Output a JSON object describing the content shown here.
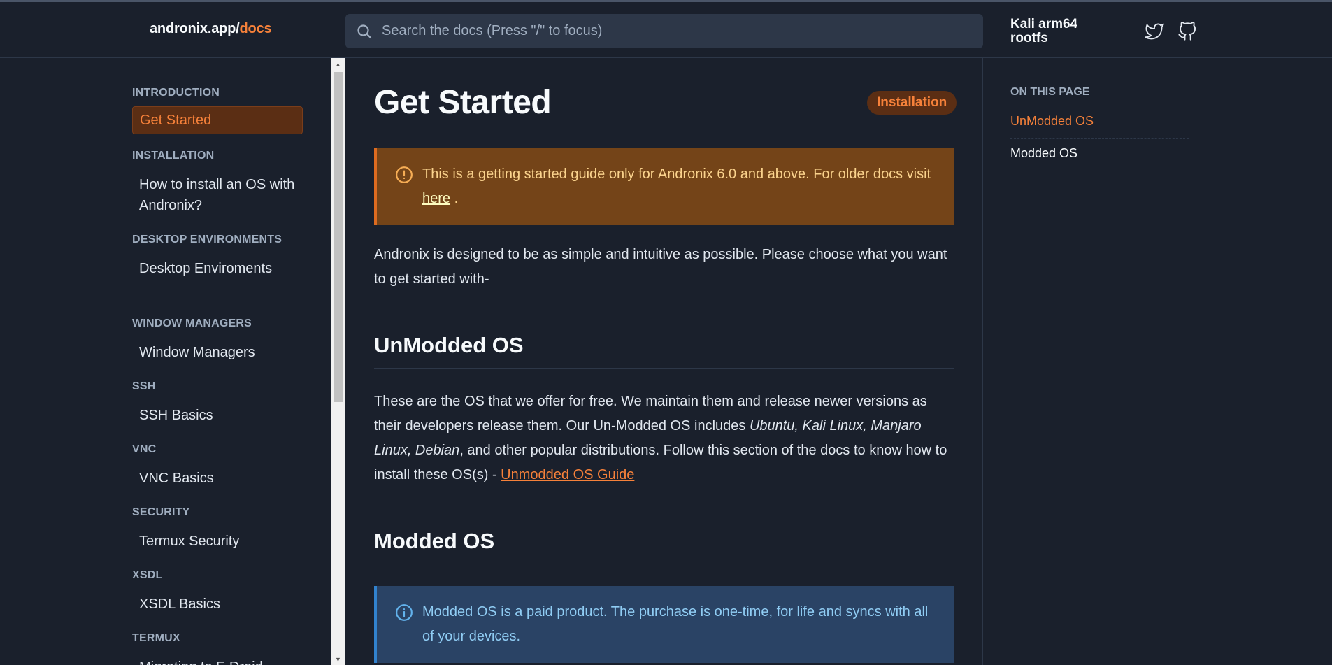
{
  "header": {
    "brand_prefix": "andronix.app/",
    "brand_accent": "docs",
    "search_placeholder": "Search the docs (Press \"/\" to focus)",
    "version_label": "Kali arm64 rootfs"
  },
  "sidebar": {
    "sections": [
      {
        "title": "INTRODUCTION",
        "items": [
          "Get Started"
        ]
      },
      {
        "title": "INSTALLATION",
        "items": [
          "How to install an OS with Andronix?"
        ]
      },
      {
        "title": "DESKTOP ENVIRONMENTS",
        "items": [
          "Desktop Enviroments"
        ]
      },
      {
        "title": "WINDOW MANAGERS",
        "items": [
          "Window Managers"
        ]
      },
      {
        "title": "SSH",
        "items": [
          "SSH Basics"
        ]
      },
      {
        "title": "VNC",
        "items": [
          "VNC Basics"
        ]
      },
      {
        "title": "SECURITY",
        "items": [
          "Termux Security"
        ]
      },
      {
        "title": "XSDL",
        "items": [
          "XSDL Basics"
        ]
      },
      {
        "title": "TERMUX",
        "items": [
          "Migrating to F-Droid"
        ]
      }
    ]
  },
  "main": {
    "title": "Get Started",
    "tag": "Installation",
    "warning": {
      "text": "This is a getting started guide only for Andronix 6.0 and above. For older docs visit",
      "link": "here",
      "end": "."
    },
    "intro": "Andronix is designed to be as simple and intuitive as possible. Please choose what you want to get started with-",
    "unmodded": {
      "heading": "UnModded OS",
      "text_a": "These are the OS that we offer for free. We maintain them and release newer versions as their developers release them. Our Un-Modded OS includes ",
      "italic": "Ubuntu, Kali Linux, Manjaro Linux, Debian",
      "text_b": ", and other popular distributions. Follow this section of the docs to know how to install these OS(s) - ",
      "link": "Unmodded OS Guide"
    },
    "modded": {
      "heading": "Modded OS",
      "info": "Modded OS is a paid product. The purchase is one-time, for life and syncs with all of your devices."
    }
  },
  "toc": {
    "title": "ON THIS PAGE",
    "items": [
      "UnModded OS",
      "Modded OS"
    ]
  },
  "colors": {
    "accent": "#f6813a",
    "background": "#1a202c",
    "warning_bg": "#744418",
    "info_bg": "#2a4365"
  }
}
